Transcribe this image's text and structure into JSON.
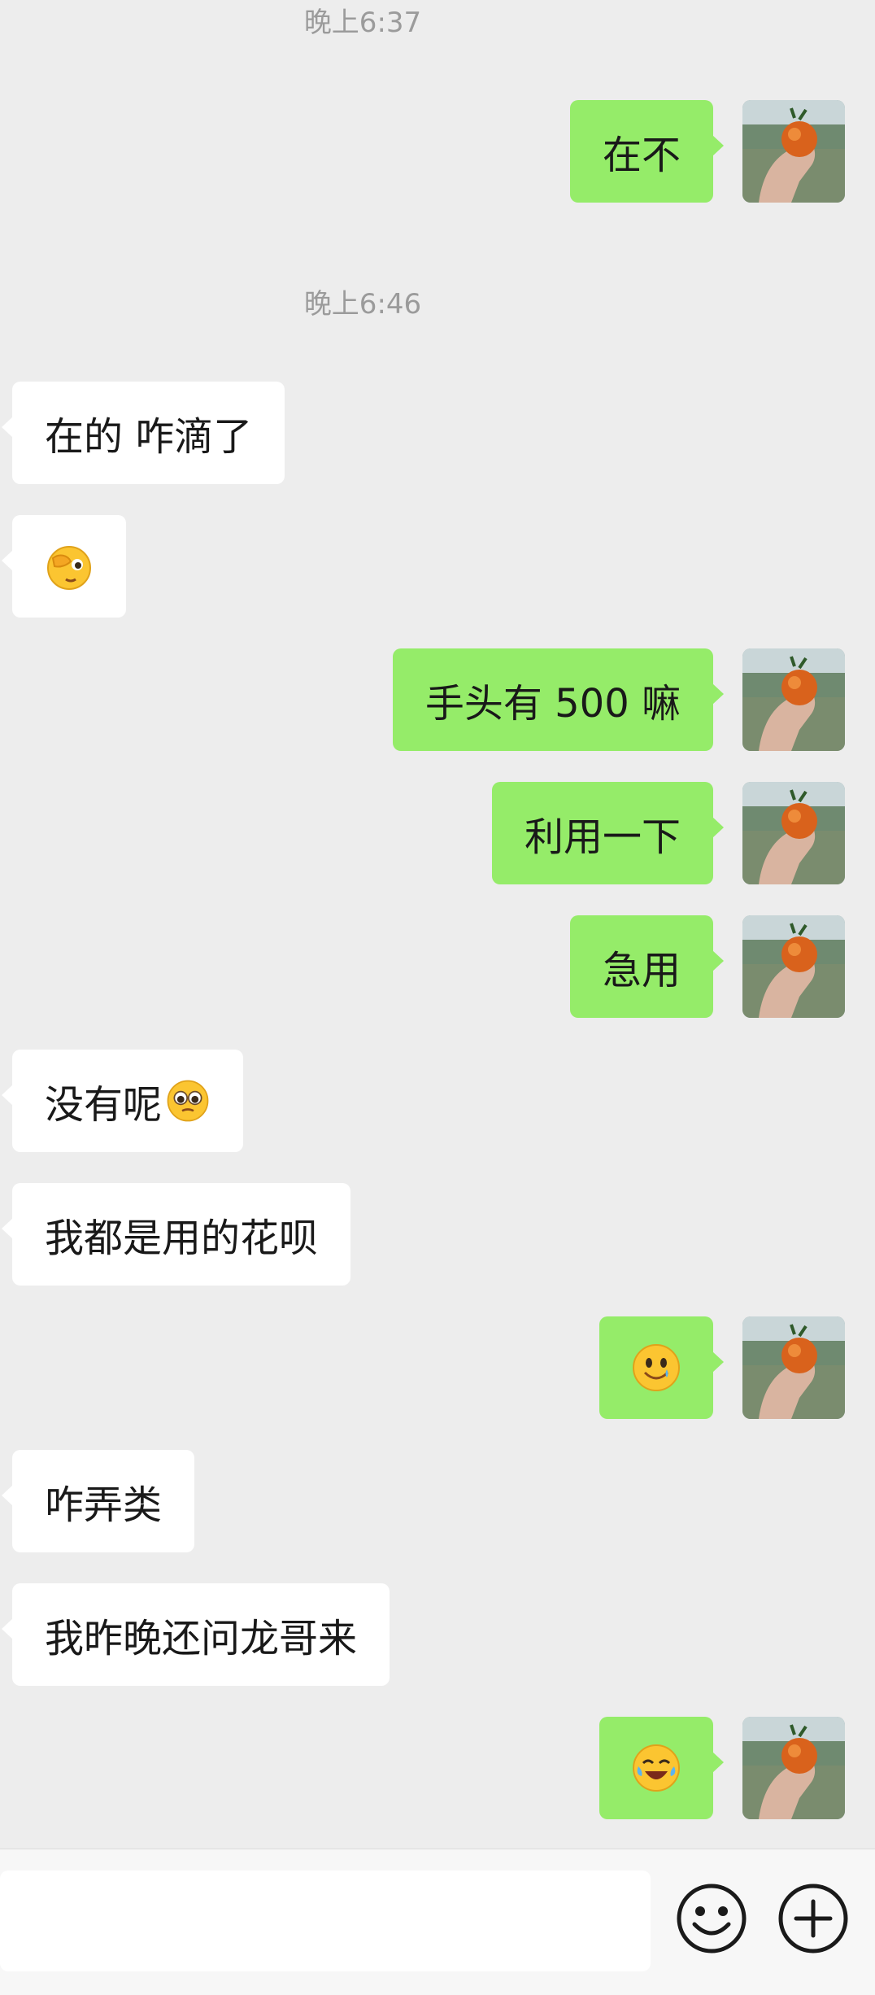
{
  "timestamps": [
    "晚上6:37",
    "晚上6:46"
  ],
  "messages": [
    {
      "side": "out",
      "text": "在不"
    },
    {
      "side": "in",
      "text": "在的 咋滴了"
    },
    {
      "side": "in",
      "emoji": "facepalm-emoji"
    },
    {
      "side": "out",
      "text": "手头有 500 嘛"
    },
    {
      "side": "out",
      "text": "利用一下"
    },
    {
      "side": "out",
      "text": "急用"
    },
    {
      "side": "in",
      "text": "没有呢",
      "emoji": "pleading-emoji"
    },
    {
      "side": "in",
      "text": "我都是用的花呗"
    },
    {
      "side": "out",
      "emoji": "smile-tear-emoji"
    },
    {
      "side": "in",
      "text": "咋弄类"
    },
    {
      "side": "in",
      "text": "我昨晚还问龙哥来"
    },
    {
      "side": "out",
      "emoji": "crying-laughing-emoji"
    }
  ],
  "input_bar": {
    "emoji_icon": "smiley-face-icon",
    "plus_icon": "plus-circle-icon"
  },
  "colors": {
    "background": "#ededed",
    "outgoing_bubble": "#95ec69",
    "incoming_bubble": "#ffffff",
    "timestamp": "#9b9b9b"
  }
}
